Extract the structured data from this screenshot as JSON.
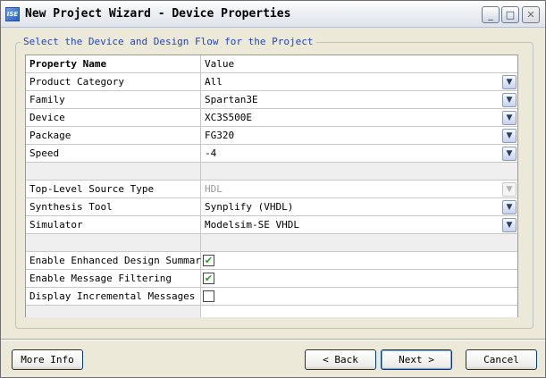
{
  "window": {
    "title": "New Project Wizard - Device Properties",
    "app_icon_text": "ISE",
    "controls": {
      "minimize": "_",
      "maximize": "□",
      "close": "✕"
    }
  },
  "group": {
    "legend": "Select the Device and Design Flow for the Project"
  },
  "grid": {
    "header": {
      "name": "Property Name",
      "value": "Value"
    },
    "rows": [
      {
        "name": "Product Category",
        "value": "All",
        "kind": "combo"
      },
      {
        "name": "Family",
        "value": "Spartan3E",
        "kind": "combo"
      },
      {
        "name": "Device",
        "value": "XC3S500E",
        "kind": "combo"
      },
      {
        "name": "Package",
        "value": "FG320",
        "kind": "combo"
      },
      {
        "name": "Speed",
        "value": "-4",
        "kind": "combo"
      },
      {
        "name": "",
        "value": "",
        "kind": "blank"
      },
      {
        "name": "Top-Level Source Type",
        "value": "HDL",
        "kind": "combo-disabled"
      },
      {
        "name": "Synthesis Tool",
        "value": "Synplify (VHDL)",
        "kind": "combo"
      },
      {
        "name": "Simulator",
        "value": "Modelsim-SE VHDL",
        "kind": "combo"
      },
      {
        "name": "",
        "value": "",
        "kind": "blank"
      },
      {
        "name": "Enable Enhanced Design Summary",
        "checked": true,
        "kind": "checkbox"
      },
      {
        "name": "Enable Message Filtering",
        "checked": true,
        "kind": "checkbox"
      },
      {
        "name": "Display Incremental Messages",
        "checked": false,
        "kind": "checkbox"
      }
    ],
    "dropdown_glyph": "▼",
    "check_glyph": "✔"
  },
  "buttons": {
    "more_info": "More Info",
    "back": "< Back",
    "next": "Next >",
    "cancel": "Cancel"
  }
}
